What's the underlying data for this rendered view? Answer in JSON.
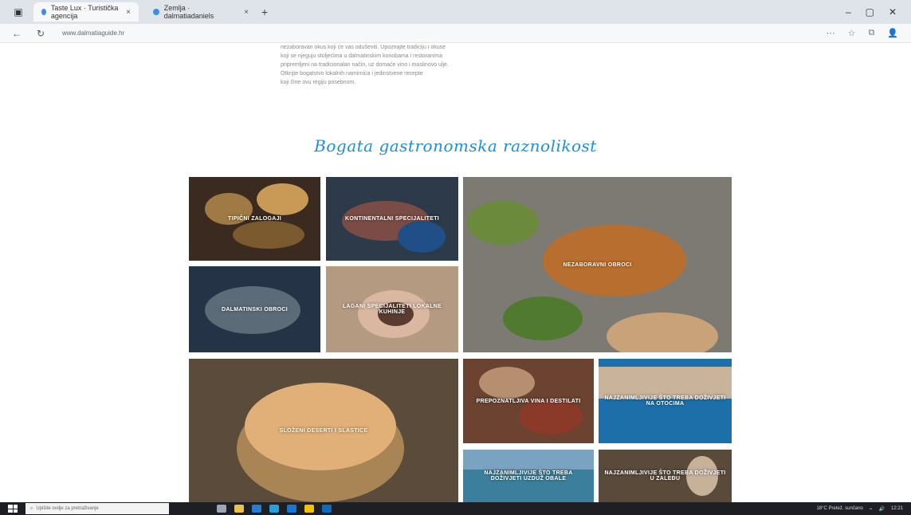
{
  "browser": {
    "tabs": [
      {
        "label": "Taste Lux · Turistička agencija",
        "active": true
      },
      {
        "label": "Zemlja · dalmatiadaniels",
        "active": false
      }
    ],
    "url": "www.dalmatiaguide.hr"
  },
  "page": {
    "intro_lines": [
      "nezaboravan okus koji će vas oduševiti. Upoznajte tradiciju i okuse",
      "koji se njeguju stoljećima u dalmatinskim konobama i restoranima",
      "pripremljeni na tradicionalan način, uz domaće vino i maslinovo ulje.",
      "Otkrijte bogatstvo lokalnih namirnica i jedinstvene recepte",
      "koji čine ovu regiju posebnom."
    ],
    "section_title": "Bogata gastronomska raznolikost"
  },
  "tiles": [
    {
      "label": "TIPIČNI ZALOGAJI",
      "bg": "#3a2a1f"
    },
    {
      "label": "KONTINENTALNI SPECIJALITETI",
      "bg": "#2c3a4a"
    },
    {
      "label": "NEZABORAVNI OBROCI",
      "bg": "#7c7a72"
    },
    {
      "label": "DALMATINSKI OBROCI",
      "bg": "#243346"
    },
    {
      "label": "LAGANI SPECIJALITETI LOKALNE KUHINJE",
      "bg": "#b59a82"
    },
    {
      "label": "SLOŽENI DESERTI I SLASTICE",
      "bg": "#5b4b3b"
    },
    {
      "label": "PREPOZNATLJIVA VINA I DESTILATI",
      "bg": "#6b4330"
    },
    {
      "label": "NAJZANIMLJIVIJE ŠTO TREBA DOŽIVJETI NA OTOCIMA",
      "bg": "#1c6fa8"
    },
    {
      "label": "NAJZANIMLJIVIJE ŠTO TREBA DOŽIVJETI UZDUŽ OBALE",
      "bg": "#3b7f9c"
    },
    {
      "label": "NAJZANIMLJIVIJE ŠTO TREBA DOŽIVJETI U ZALEĐU",
      "bg": "#5a4a3a"
    }
  ],
  "taskbar": {
    "search_placeholder": "Upišite ovdje za pretraživanje",
    "weather": "18°C Pretež. sunčano",
    "time": "12:21"
  },
  "colors": {
    "title_accent": "#1e8fd6"
  }
}
